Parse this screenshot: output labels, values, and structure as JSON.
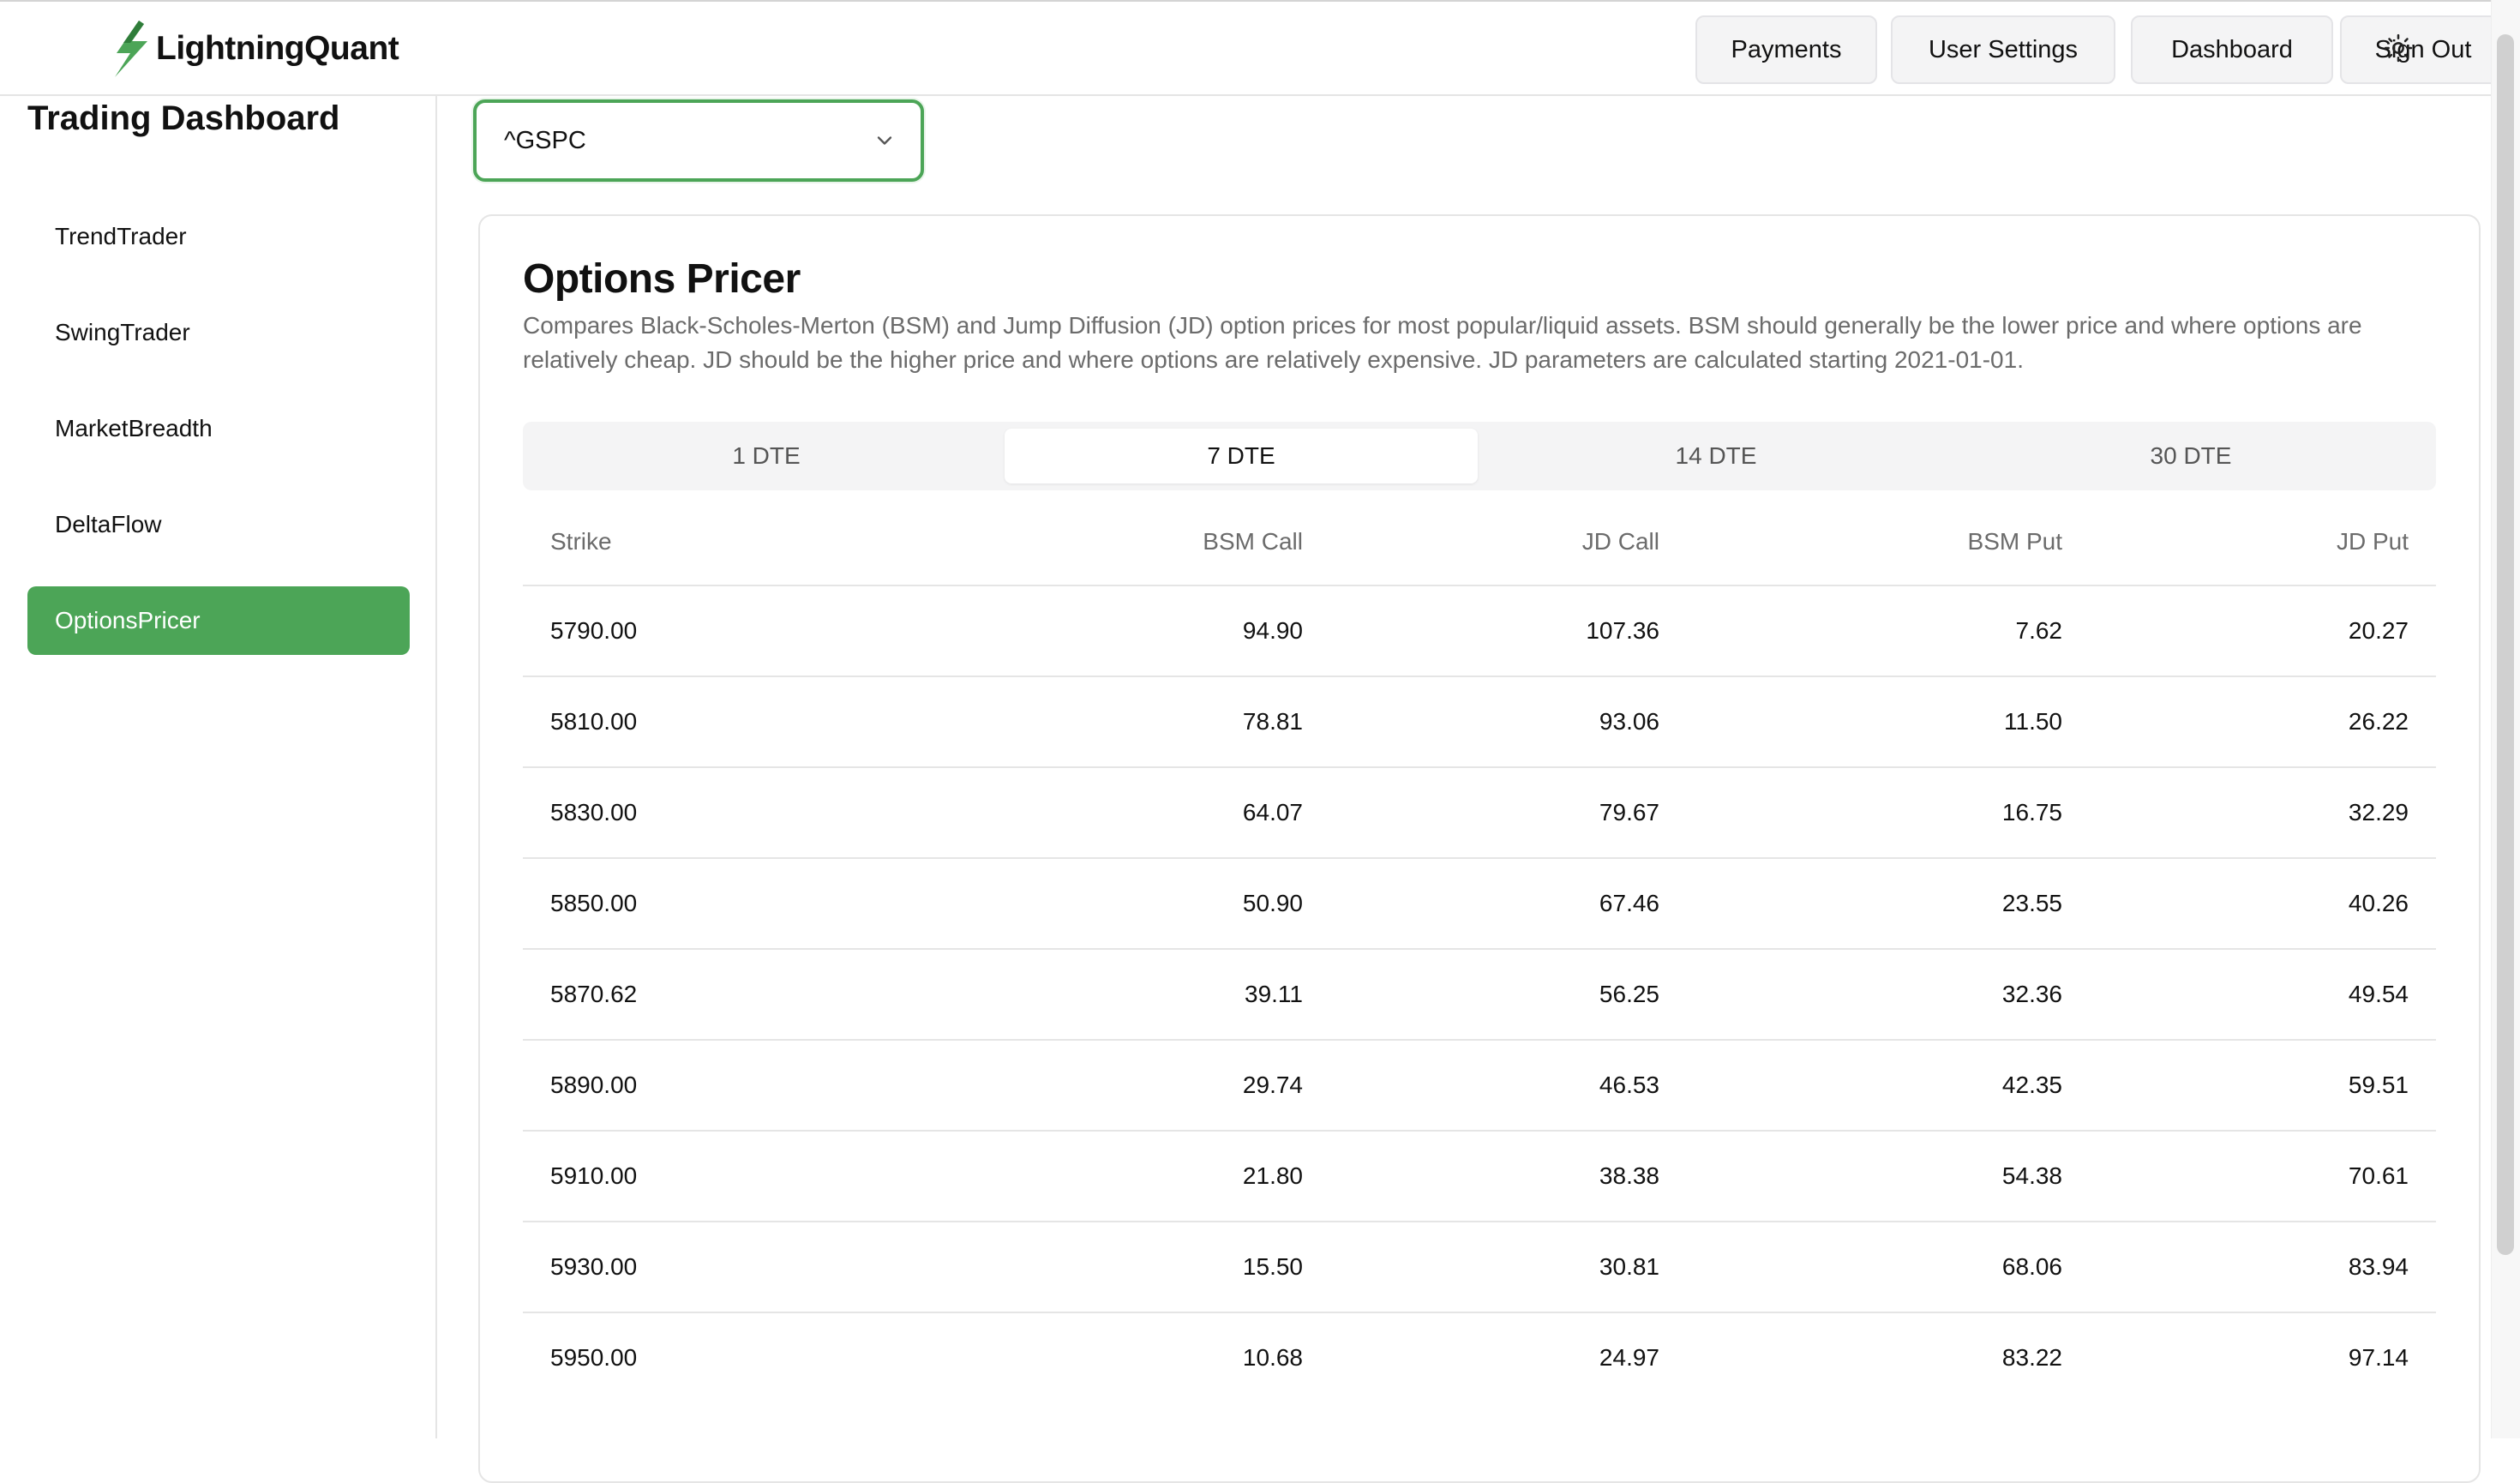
{
  "header": {
    "brand": "LightningQuant",
    "nav": {
      "payments": "Payments",
      "user_settings": "User Settings",
      "dashboard": "Dashboard",
      "sign_out": "Sign Out"
    },
    "theme_icon": "sun-icon"
  },
  "sidebar": {
    "title": "Trading Dashboard",
    "items": [
      {
        "label": "TrendTrader",
        "active": false
      },
      {
        "label": "SwingTrader",
        "active": false
      },
      {
        "label": "MarketBreadth",
        "active": false
      },
      {
        "label": "DeltaFlow",
        "active": false
      },
      {
        "label": "OptionsPricer",
        "active": true
      }
    ]
  },
  "ticker_select": {
    "value": "^GSPC",
    "icon": "chevron-down-icon"
  },
  "card": {
    "title": "Options Pricer",
    "description": "Compares Black-Scholes-Merton (BSM) and Jump Diffusion (JD) option prices for most popular/liquid assets. BSM should generally be the lower price and where options are relatively cheap. JD should be the higher price and where options are relatively expensive. JD parameters are calculated starting 2021-01-01.",
    "tabs": [
      {
        "label": "1 DTE",
        "active": false
      },
      {
        "label": "7 DTE",
        "active": true
      },
      {
        "label": "14 DTE",
        "active": false
      },
      {
        "label": "30 DTE",
        "active": false
      }
    ]
  },
  "table": {
    "headers": [
      "Strike",
      "BSM Call",
      "JD Call",
      "BSM Put",
      "JD Put"
    ],
    "rows": [
      [
        "5790.00",
        "94.90",
        "107.36",
        "7.62",
        "20.27"
      ],
      [
        "5810.00",
        "78.81",
        "93.06",
        "11.50",
        "26.22"
      ],
      [
        "5830.00",
        "64.07",
        "79.67",
        "16.75",
        "32.29"
      ],
      [
        "5850.00",
        "50.90",
        "67.46",
        "23.55",
        "40.26"
      ],
      [
        "5870.62",
        "39.11",
        "56.25",
        "32.36",
        "49.54"
      ],
      [
        "5890.00",
        "29.74",
        "46.53",
        "42.35",
        "59.51"
      ],
      [
        "5910.00",
        "21.80",
        "38.38",
        "54.38",
        "70.61"
      ],
      [
        "5930.00",
        "15.50",
        "30.81",
        "68.06",
        "83.94"
      ],
      [
        "5950.00",
        "10.68",
        "24.97",
        "83.22",
        "97.14"
      ]
    ]
  },
  "colors": {
    "accent": "#4ca557",
    "muted_text": "#6b6b6b",
    "border": "#e5e5e5"
  }
}
